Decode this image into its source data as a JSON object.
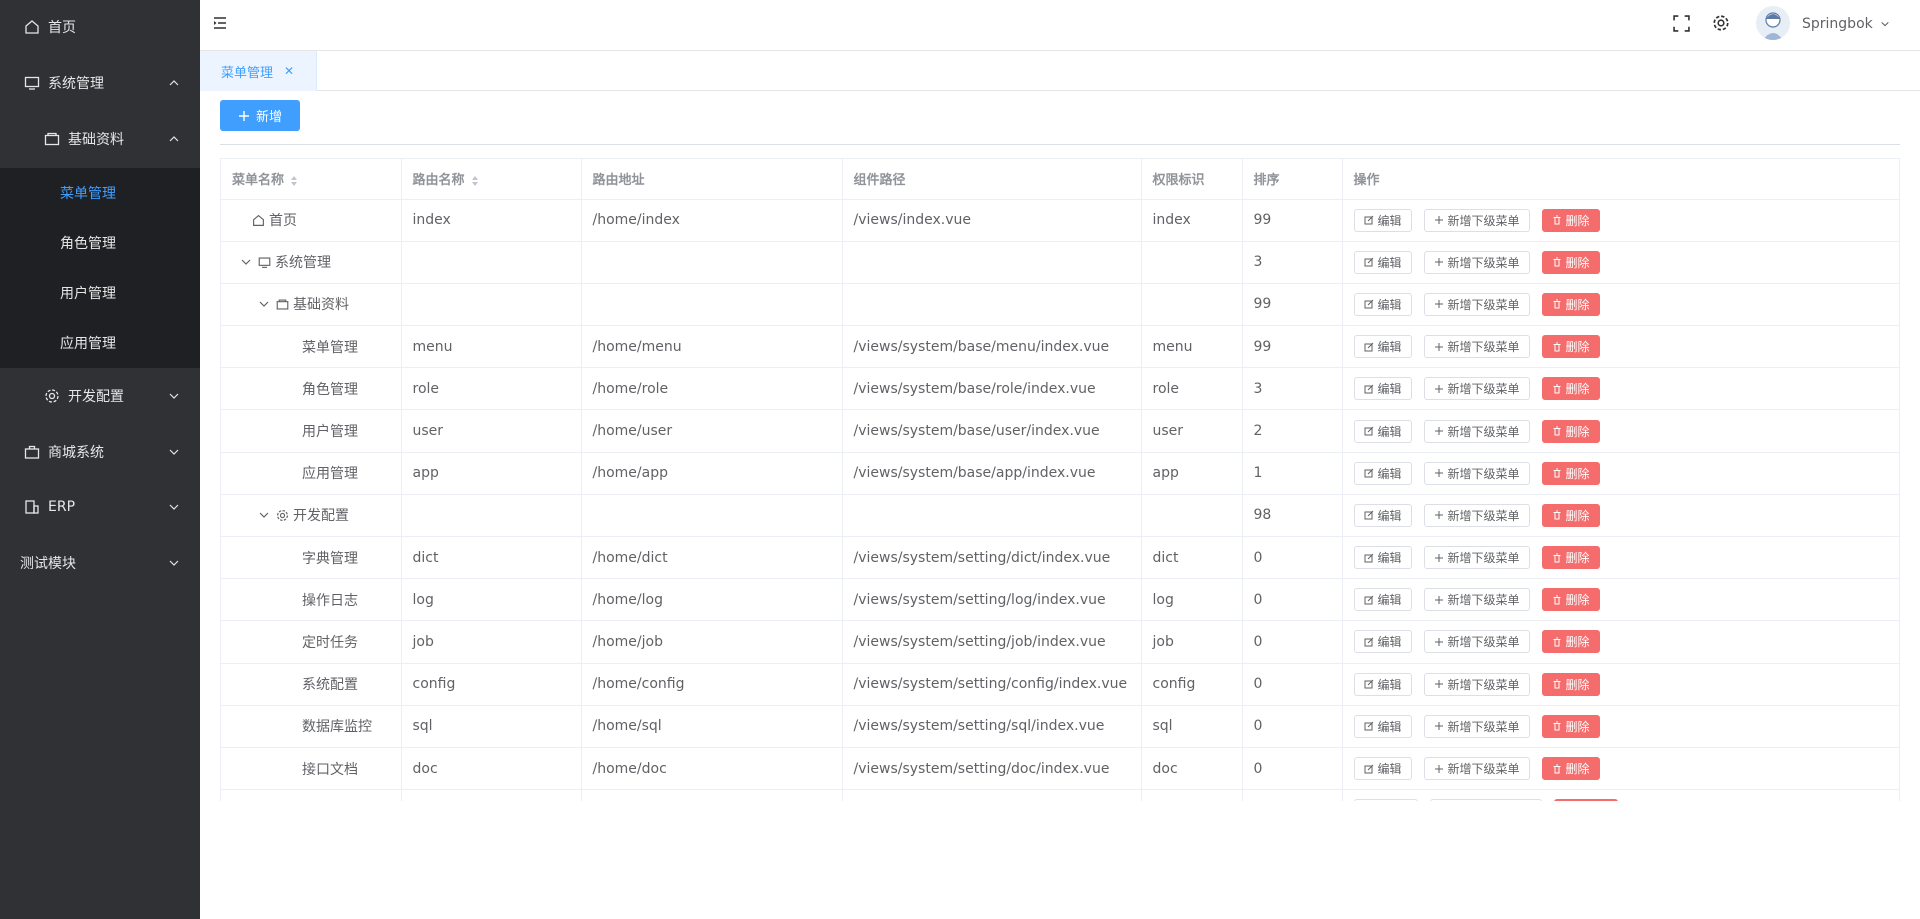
{
  "sidebar": {
    "items": [
      {
        "label": "首页",
        "icon": "home-icon"
      },
      {
        "label": "系统管理",
        "icon": "monitor-icon"
      },
      {
        "label": "基础资料",
        "icon": "folder-icon"
      },
      {
        "label": "菜单管理"
      },
      {
        "label": "角色管理"
      },
      {
        "label": "用户管理"
      },
      {
        "label": "应用管理"
      },
      {
        "label": "开发配置",
        "icon": "gear-icon"
      },
      {
        "label": "商城系统",
        "icon": "briefcase-icon"
      },
      {
        "label": "ERP",
        "icon": "building-icon"
      },
      {
        "label": "测试模块"
      }
    ]
  },
  "header": {
    "username": "Springbok"
  },
  "tabs": [
    {
      "label": "菜单管理"
    }
  ],
  "toolbar": {
    "add_label": "新增"
  },
  "table": {
    "headers": [
      "菜单名称",
      "路由名称",
      "路由地址",
      "组件路径",
      "权限标识",
      "排序",
      "操作"
    ],
    "rows": [
      {
        "name": "首页",
        "route_name": "index",
        "path": "/home/index",
        "component": "/views/index.vue",
        "perm": "index",
        "sort": "99"
      },
      {
        "name": "系统管理",
        "route_name": "",
        "path": "",
        "component": "",
        "perm": "",
        "sort": "3"
      },
      {
        "name": "基础资料",
        "route_name": "",
        "path": "",
        "component": "",
        "perm": "",
        "sort": "99"
      },
      {
        "name": "菜单管理",
        "route_name": "menu",
        "path": "/home/menu",
        "component": "/views/system/base/menu/index.vue",
        "perm": "menu",
        "sort": "99"
      },
      {
        "name": "角色管理",
        "route_name": "role",
        "path": "/home/role",
        "component": "/views/system/base/role/index.vue",
        "perm": "role",
        "sort": "3"
      },
      {
        "name": "用户管理",
        "route_name": "user",
        "path": "/home/user",
        "component": "/views/system/base/user/index.vue",
        "perm": "user",
        "sort": "2"
      },
      {
        "name": "应用管理",
        "route_name": "app",
        "path": "/home/app",
        "component": "/views/system/base/app/index.vue",
        "perm": "app",
        "sort": "1"
      },
      {
        "name": "开发配置",
        "route_name": "",
        "path": "",
        "component": "",
        "perm": "",
        "sort": "98"
      },
      {
        "name": "字典管理",
        "route_name": "dict",
        "path": "/home/dict",
        "component": "/views/system/setting/dict/index.vue",
        "perm": "dict",
        "sort": "0"
      },
      {
        "name": "操作日志",
        "route_name": "log",
        "path": "/home/log",
        "component": "/views/system/setting/log/index.vue",
        "perm": "log",
        "sort": "0"
      },
      {
        "name": "定时任务",
        "route_name": "job",
        "path": "/home/job",
        "component": "/views/system/setting/job/index.vue",
        "perm": "job",
        "sort": "0"
      },
      {
        "name": "系统配置",
        "route_name": "config",
        "path": "/home/config",
        "component": "/views/system/setting/config/index.vue",
        "perm": "config",
        "sort": "0"
      },
      {
        "name": "数据库监控",
        "route_name": "sql",
        "path": "/home/sql",
        "component": "/views/system/setting/sql/index.vue",
        "perm": "sql",
        "sort": "0"
      },
      {
        "name": "接口文档",
        "route_name": "doc",
        "path": "/home/doc",
        "component": "/views/system/setting/doc/index.vue",
        "perm": "doc",
        "sort": "0"
      }
    ],
    "actions": {
      "edit": "编辑",
      "add_child": "新增下级菜单",
      "delete": "删除"
    }
  }
}
